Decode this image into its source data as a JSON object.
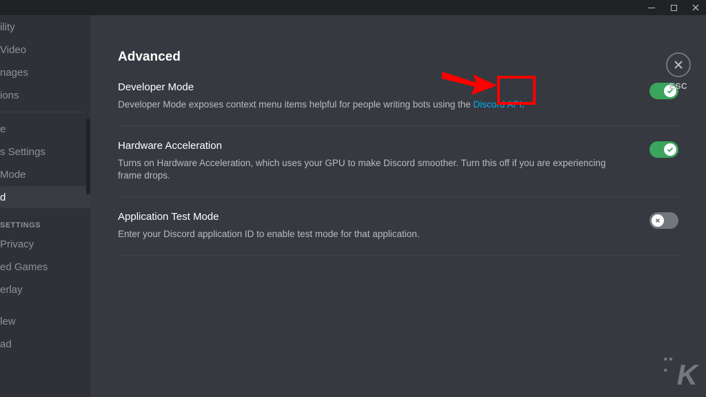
{
  "titlebar": {
    "min": "—",
    "max": "▢",
    "close": "✕"
  },
  "sidebar": {
    "items_top": [
      "ility",
      "Video",
      "nages",
      "ions",
      "",
      "e",
      "s Settings",
      "Mode",
      "d"
    ],
    "selected_index": 8,
    "section_header": "SETTINGS",
    "items_bottom": [
      "Privacy",
      "ed Games",
      "erlay",
      "lew",
      "ad"
    ]
  },
  "page": {
    "title": "Advanced",
    "close_label": "ESC"
  },
  "settings": [
    {
      "title": "Developer Mode",
      "desc_pre": "Developer Mode exposes context menu items helpful for people writing bots using the ",
      "desc_link": "Discord API",
      "desc_post": ".",
      "on": true
    },
    {
      "title": "Hardware Acceleration",
      "desc_pre": "Turns on Hardware Acceleration, which uses your GPU to make Discord smoother. Turn this off if you are experiencing frame drops.",
      "desc_link": "",
      "desc_post": "",
      "on": true
    },
    {
      "title": "Application Test Mode",
      "desc_pre": "Enter your Discord application ID to enable test mode for that application.",
      "desc_link": "",
      "desc_post": "",
      "on": false
    }
  ],
  "watermark": "K"
}
